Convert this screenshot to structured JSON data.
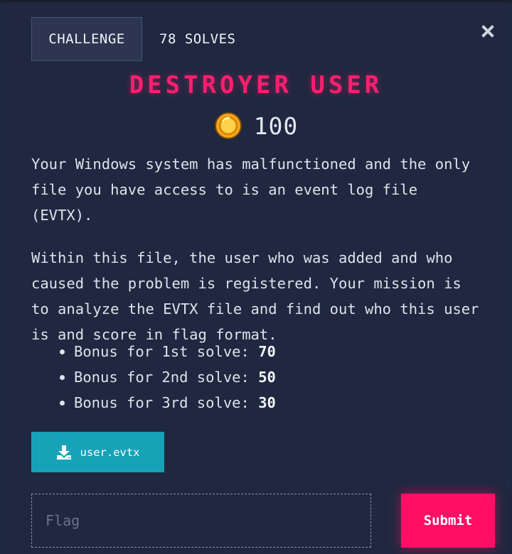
{
  "tabs": [
    {
      "label": "CHALLENGE",
      "active": true
    },
    {
      "label": "78 SOLVES",
      "active": false
    }
  ],
  "challenge": {
    "title": "DESTROYER USER",
    "points": "100",
    "description": [
      "Your Windows system has malfunctioned and the only file you have access to is an event log file (EVTX).",
      "Within this file, the user who was added and who caused the problem is registered. Your mission is to analyze the EVTX file and find out who this user is and score in flag format."
    ],
    "bonuses": [
      {
        "label": "Bonus for 1st solve: ",
        "value": "70"
      },
      {
        "label": "Bonus for 2nd solve: ",
        "value": "50"
      },
      {
        "label": "Bonus for 3rd solve: ",
        "value": "30"
      }
    ]
  },
  "file": {
    "name": "user.evtx",
    "icon": "download-icon"
  },
  "flag_input": {
    "placeholder": "Flag",
    "value": ""
  },
  "submit_label": "Submit",
  "colors": {
    "background": "#1f2840",
    "title": "#ff1f6e",
    "download_button": "#17a2b8",
    "submit_button": "#ff0f63"
  }
}
